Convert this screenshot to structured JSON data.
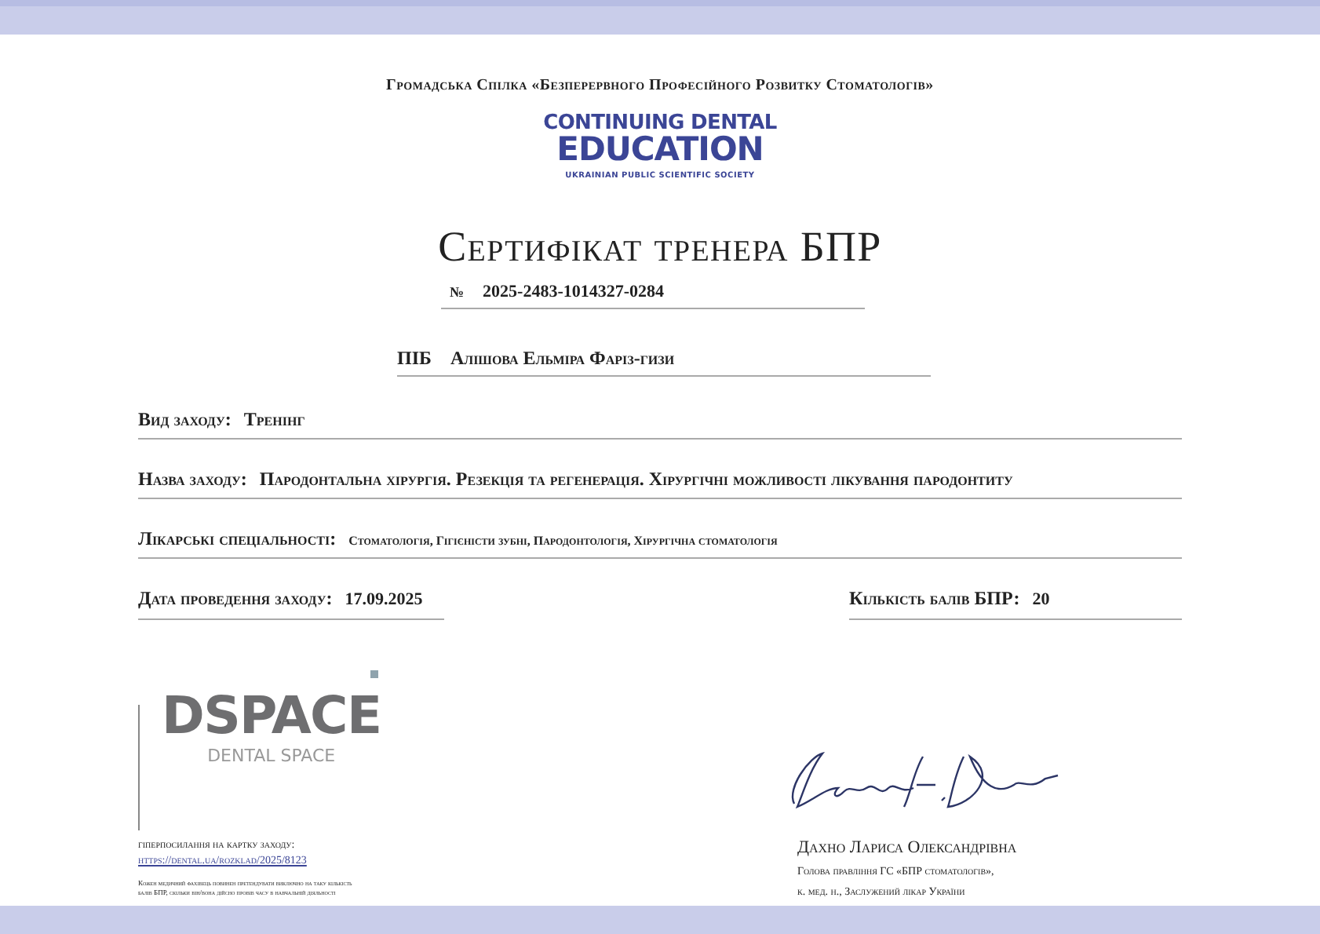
{
  "organization": "Громадська Спілка «Безперервного Професійного Розвитку Стоматологів»",
  "logo": {
    "line_1": "CONTINUING DENTAL",
    "line_2": "EDUCATION",
    "tagline": "UKRAINIAN PUBLIC SCIENTIFIC SOCIETY"
  },
  "title": "Сертифікат тренера БПР",
  "number": {
    "label": "№",
    "value": "2025-2483-1014327-0284"
  },
  "name": {
    "label": "ПІБ",
    "value": "Алішова Ельміра Фаріз-гизи"
  },
  "fields": [
    {
      "label": "Вид заходу:",
      "value": "Тренінг",
      "kind": "normal"
    },
    {
      "label": "Назва заходу:",
      "value": "Пародонтальна хірургія. Резекція та регенерація. Хірургічні можливості лікування пародонтиту",
      "kind": "normal"
    },
    {
      "label": "Лікарські спеціальності:",
      "value": "Стоматологія, Гігієністи зубні, Пародонтологія, Хірургічна стоматологія",
      "kind": "small"
    }
  ],
  "date": {
    "label": "Дата проведення заходу:",
    "value": "17.09.2025"
  },
  "points": {
    "label": "Кількість балів БПР:",
    "value": "20"
  },
  "sponsor_logo": {
    "name": "DSPACE",
    "subtitle": "DENTAL SPACE"
  },
  "link": {
    "label": "гіперпосилання на картку заходу:",
    "url": "https://dental.ua/rozklad/2025/8123"
  },
  "disclaimer": "Кожен медичний фахівець повинен претендувати виключно на таку кількість балів БПР, скільки він/вона дійсно провів часу в навчальній діяльності",
  "signatory": {
    "name": "Дахно Лариса Олександрівна",
    "position": "Голова правління ГС «БПР стоматологів»,",
    "credentials": "к. мед. н., Заслужений лікар України"
  }
}
